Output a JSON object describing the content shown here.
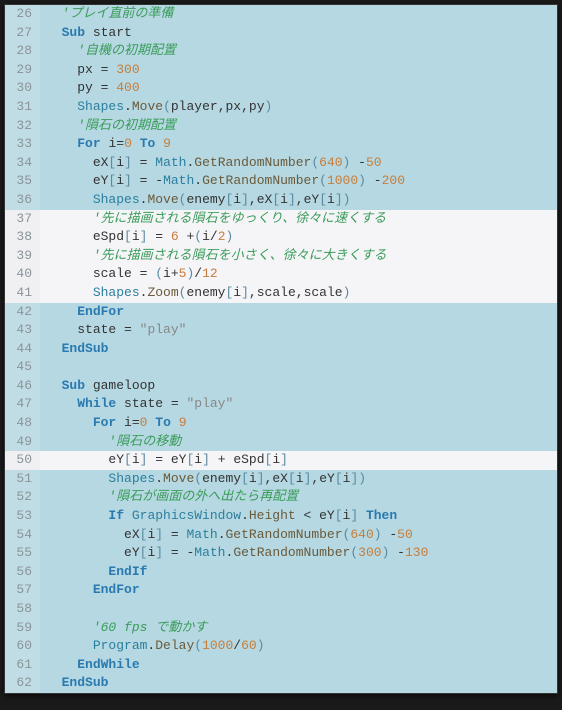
{
  "lines": [
    {
      "n": 26,
      "indent": 1,
      "hl": false,
      "tokens": [
        {
          "t": "'プレイ直前の準備",
          "c": "cm"
        }
      ]
    },
    {
      "n": 27,
      "indent": 1,
      "hl": false,
      "tokens": [
        {
          "t": "Sub",
          "c": "kw"
        },
        {
          "t": " ",
          "c": "op"
        },
        {
          "t": "start",
          "c": "id"
        }
      ]
    },
    {
      "n": 28,
      "indent": 2,
      "hl": false,
      "tokens": [
        {
          "t": "'自機の初期配置",
          "c": "cm"
        }
      ]
    },
    {
      "n": 29,
      "indent": 2,
      "hl": false,
      "tokens": [
        {
          "t": "px",
          "c": "id"
        },
        {
          "t": " = ",
          "c": "op"
        },
        {
          "t": "300",
          "c": "num"
        }
      ]
    },
    {
      "n": 30,
      "indent": 2,
      "hl": false,
      "tokens": [
        {
          "t": "py",
          "c": "id"
        },
        {
          "t": " = ",
          "c": "op"
        },
        {
          "t": "400",
          "c": "num"
        }
      ]
    },
    {
      "n": 31,
      "indent": 2,
      "hl": false,
      "tokens": [
        {
          "t": "Shapes",
          "c": "cls"
        },
        {
          "t": ".",
          "c": "op"
        },
        {
          "t": "Move",
          "c": "fn"
        },
        {
          "t": "(",
          "c": "br"
        },
        {
          "t": "player",
          "c": "id"
        },
        {
          "t": ",",
          "c": "op"
        },
        {
          "t": "px",
          "c": "id"
        },
        {
          "t": ",",
          "c": "op"
        },
        {
          "t": "py",
          "c": "id"
        },
        {
          "t": ")",
          "c": "br"
        }
      ]
    },
    {
      "n": 32,
      "indent": 2,
      "hl": false,
      "tokens": [
        {
          "t": "'隕石の初期配置",
          "c": "cm"
        }
      ]
    },
    {
      "n": 33,
      "indent": 2,
      "hl": false,
      "tokens": [
        {
          "t": "For",
          "c": "kw"
        },
        {
          "t": " ",
          "c": "op"
        },
        {
          "t": "i",
          "c": "id"
        },
        {
          "t": "=",
          "c": "op"
        },
        {
          "t": "0",
          "c": "num"
        },
        {
          "t": " ",
          "c": "op"
        },
        {
          "t": "To",
          "c": "kw"
        },
        {
          "t": " ",
          "c": "op"
        },
        {
          "t": "9",
          "c": "num"
        }
      ]
    },
    {
      "n": 34,
      "indent": 3,
      "hl": false,
      "tokens": [
        {
          "t": "eX",
          "c": "id"
        },
        {
          "t": "[",
          "c": "br"
        },
        {
          "t": "i",
          "c": "id"
        },
        {
          "t": "]",
          "c": "br"
        },
        {
          "t": " = ",
          "c": "op"
        },
        {
          "t": "Math",
          "c": "cls"
        },
        {
          "t": ".",
          "c": "op"
        },
        {
          "t": "GetRandomNumber",
          "c": "fn"
        },
        {
          "t": "(",
          "c": "br"
        },
        {
          "t": "640",
          "c": "num"
        },
        {
          "t": ")",
          "c": "br"
        },
        {
          "t": " -",
          "c": "op"
        },
        {
          "t": "50",
          "c": "num"
        }
      ]
    },
    {
      "n": 35,
      "indent": 3,
      "hl": false,
      "tokens": [
        {
          "t": "eY",
          "c": "id"
        },
        {
          "t": "[",
          "c": "br"
        },
        {
          "t": "i",
          "c": "id"
        },
        {
          "t": "]",
          "c": "br"
        },
        {
          "t": " = -",
          "c": "op"
        },
        {
          "t": "Math",
          "c": "cls"
        },
        {
          "t": ".",
          "c": "op"
        },
        {
          "t": "GetRandomNumber",
          "c": "fn"
        },
        {
          "t": "(",
          "c": "br"
        },
        {
          "t": "1000",
          "c": "num"
        },
        {
          "t": ")",
          "c": "br"
        },
        {
          "t": " -",
          "c": "op"
        },
        {
          "t": "200",
          "c": "num"
        }
      ]
    },
    {
      "n": 36,
      "indent": 3,
      "hl": false,
      "tokens": [
        {
          "t": "Shapes",
          "c": "cls"
        },
        {
          "t": ".",
          "c": "op"
        },
        {
          "t": "Move",
          "c": "fn"
        },
        {
          "t": "(",
          "c": "br"
        },
        {
          "t": "enemy",
          "c": "id"
        },
        {
          "t": "[",
          "c": "br"
        },
        {
          "t": "i",
          "c": "id"
        },
        {
          "t": "]",
          "c": "br"
        },
        {
          "t": ",",
          "c": "op"
        },
        {
          "t": "eX",
          "c": "id"
        },
        {
          "t": "[",
          "c": "br"
        },
        {
          "t": "i",
          "c": "id"
        },
        {
          "t": "]",
          "c": "br"
        },
        {
          "t": ",",
          "c": "op"
        },
        {
          "t": "eY",
          "c": "id"
        },
        {
          "t": "[",
          "c": "br"
        },
        {
          "t": "i",
          "c": "id"
        },
        {
          "t": "]",
          "c": "br"
        },
        {
          "t": ")",
          "c": "br"
        }
      ]
    },
    {
      "n": 37,
      "indent": 3,
      "hl": true,
      "tokens": [
        {
          "t": "'先に描画される隕石をゆっくり、徐々に速くする",
          "c": "cm"
        }
      ]
    },
    {
      "n": 38,
      "indent": 3,
      "hl": true,
      "tokens": [
        {
          "t": "eSpd",
          "c": "id"
        },
        {
          "t": "[",
          "c": "br"
        },
        {
          "t": "i",
          "c": "id"
        },
        {
          "t": "]",
          "c": "br"
        },
        {
          "t": " = ",
          "c": "op"
        },
        {
          "t": "6",
          "c": "num"
        },
        {
          "t": " +",
          "c": "op"
        },
        {
          "t": "(",
          "c": "br"
        },
        {
          "t": "i",
          "c": "id"
        },
        {
          "t": "/",
          "c": "op"
        },
        {
          "t": "2",
          "c": "num"
        },
        {
          "t": ")",
          "c": "br"
        }
      ]
    },
    {
      "n": 39,
      "indent": 3,
      "hl": true,
      "tokens": [
        {
          "t": "'先に描画される隕石を小さく、徐々に大きくする",
          "c": "cm"
        }
      ]
    },
    {
      "n": 40,
      "indent": 3,
      "hl": true,
      "tokens": [
        {
          "t": "scale",
          "c": "id"
        },
        {
          "t": " = ",
          "c": "op"
        },
        {
          "t": "(",
          "c": "br"
        },
        {
          "t": "i",
          "c": "id"
        },
        {
          "t": "+",
          "c": "op"
        },
        {
          "t": "5",
          "c": "num"
        },
        {
          "t": ")",
          "c": "br"
        },
        {
          "t": "/",
          "c": "op"
        },
        {
          "t": "12",
          "c": "num"
        }
      ]
    },
    {
      "n": 41,
      "indent": 3,
      "hl": true,
      "tokens": [
        {
          "t": "Shapes",
          "c": "cls"
        },
        {
          "t": ".",
          "c": "op"
        },
        {
          "t": "Zoom",
          "c": "fn"
        },
        {
          "t": "(",
          "c": "br"
        },
        {
          "t": "enemy",
          "c": "id"
        },
        {
          "t": "[",
          "c": "br"
        },
        {
          "t": "i",
          "c": "id"
        },
        {
          "t": "]",
          "c": "br"
        },
        {
          "t": ",",
          "c": "op"
        },
        {
          "t": "scale",
          "c": "id"
        },
        {
          "t": ",",
          "c": "op"
        },
        {
          "t": "scale",
          "c": "id"
        },
        {
          "t": ")",
          "c": "br"
        }
      ]
    },
    {
      "n": 42,
      "indent": 2,
      "hl": false,
      "tokens": [
        {
          "t": "EndFor",
          "c": "kw"
        }
      ]
    },
    {
      "n": 43,
      "indent": 2,
      "hl": false,
      "tokens": [
        {
          "t": "state",
          "c": "id"
        },
        {
          "t": " = ",
          "c": "op"
        },
        {
          "t": "\"play\"",
          "c": "str"
        }
      ]
    },
    {
      "n": 44,
      "indent": 1,
      "hl": false,
      "tokens": [
        {
          "t": "EndSub",
          "c": "kw"
        }
      ]
    },
    {
      "n": 45,
      "indent": 1,
      "hl": false,
      "tokens": []
    },
    {
      "n": 46,
      "indent": 1,
      "hl": false,
      "tokens": [
        {
          "t": "Sub",
          "c": "kw"
        },
        {
          "t": " ",
          "c": "op"
        },
        {
          "t": "gameloop",
          "c": "id"
        }
      ]
    },
    {
      "n": 47,
      "indent": 2,
      "hl": false,
      "tokens": [
        {
          "t": "While",
          "c": "kw"
        },
        {
          "t": " ",
          "c": "op"
        },
        {
          "t": "state",
          "c": "id"
        },
        {
          "t": " = ",
          "c": "op"
        },
        {
          "t": "\"play\"",
          "c": "str"
        }
      ]
    },
    {
      "n": 48,
      "indent": 3,
      "hl": false,
      "tokens": [
        {
          "t": "For",
          "c": "kw"
        },
        {
          "t": " ",
          "c": "op"
        },
        {
          "t": "i",
          "c": "id"
        },
        {
          "t": "=",
          "c": "op"
        },
        {
          "t": "0",
          "c": "num"
        },
        {
          "t": " ",
          "c": "op"
        },
        {
          "t": "To",
          "c": "kw"
        },
        {
          "t": " ",
          "c": "op"
        },
        {
          "t": "9",
          "c": "num"
        }
      ]
    },
    {
      "n": 49,
      "indent": 4,
      "hl": false,
      "tokens": [
        {
          "t": "'隕石の移動",
          "c": "cm"
        }
      ]
    },
    {
      "n": 50,
      "indent": 4,
      "hl": true,
      "tokens": [
        {
          "t": "eY",
          "c": "id"
        },
        {
          "t": "[",
          "c": "br"
        },
        {
          "t": "i",
          "c": "id"
        },
        {
          "t": "]",
          "c": "br"
        },
        {
          "t": " = ",
          "c": "op"
        },
        {
          "t": "eY",
          "c": "id"
        },
        {
          "t": "[",
          "c": "br"
        },
        {
          "t": "i",
          "c": "id"
        },
        {
          "t": "]",
          "c": "br"
        },
        {
          "t": " + ",
          "c": "op"
        },
        {
          "t": "eSpd",
          "c": "id"
        },
        {
          "t": "[",
          "c": "br"
        },
        {
          "t": "i",
          "c": "id"
        },
        {
          "t": "]",
          "c": "br"
        }
      ]
    },
    {
      "n": 51,
      "indent": 4,
      "hl": false,
      "tokens": [
        {
          "t": "Shapes",
          "c": "cls"
        },
        {
          "t": ".",
          "c": "op"
        },
        {
          "t": "Move",
          "c": "fn"
        },
        {
          "t": "(",
          "c": "br"
        },
        {
          "t": "enemy",
          "c": "id"
        },
        {
          "t": "[",
          "c": "br"
        },
        {
          "t": "i",
          "c": "id"
        },
        {
          "t": "]",
          "c": "br"
        },
        {
          "t": ",",
          "c": "op"
        },
        {
          "t": "eX",
          "c": "id"
        },
        {
          "t": "[",
          "c": "br"
        },
        {
          "t": "i",
          "c": "id"
        },
        {
          "t": "]",
          "c": "br"
        },
        {
          "t": ",",
          "c": "op"
        },
        {
          "t": "eY",
          "c": "id"
        },
        {
          "t": "[",
          "c": "br"
        },
        {
          "t": "i",
          "c": "id"
        },
        {
          "t": "]",
          "c": "br"
        },
        {
          "t": ")",
          "c": "br"
        }
      ]
    },
    {
      "n": 52,
      "indent": 4,
      "hl": false,
      "tokens": [
        {
          "t": "'隕石が画面の外へ出たら再配置",
          "c": "cm"
        }
      ]
    },
    {
      "n": 53,
      "indent": 4,
      "hl": false,
      "tokens": [
        {
          "t": "If",
          "c": "kw"
        },
        {
          "t": " ",
          "c": "op"
        },
        {
          "t": "GraphicsWindow",
          "c": "cls"
        },
        {
          "t": ".",
          "c": "op"
        },
        {
          "t": "Height",
          "c": "fn"
        },
        {
          "t": " < ",
          "c": "op"
        },
        {
          "t": "eY",
          "c": "id"
        },
        {
          "t": "[",
          "c": "br"
        },
        {
          "t": "i",
          "c": "id"
        },
        {
          "t": "]",
          "c": "br"
        },
        {
          "t": " ",
          "c": "op"
        },
        {
          "t": "Then",
          "c": "kw"
        }
      ]
    },
    {
      "n": 54,
      "indent": 5,
      "hl": false,
      "tokens": [
        {
          "t": "eX",
          "c": "id"
        },
        {
          "t": "[",
          "c": "br"
        },
        {
          "t": "i",
          "c": "id"
        },
        {
          "t": "]",
          "c": "br"
        },
        {
          "t": " = ",
          "c": "op"
        },
        {
          "t": "Math",
          "c": "cls"
        },
        {
          "t": ".",
          "c": "op"
        },
        {
          "t": "GetRandomNumber",
          "c": "fn"
        },
        {
          "t": "(",
          "c": "br"
        },
        {
          "t": "640",
          "c": "num"
        },
        {
          "t": ")",
          "c": "br"
        },
        {
          "t": " -",
          "c": "op"
        },
        {
          "t": "50",
          "c": "num"
        }
      ]
    },
    {
      "n": 55,
      "indent": 5,
      "hl": false,
      "tokens": [
        {
          "t": "eY",
          "c": "id"
        },
        {
          "t": "[",
          "c": "br"
        },
        {
          "t": "i",
          "c": "id"
        },
        {
          "t": "]",
          "c": "br"
        },
        {
          "t": " = -",
          "c": "op"
        },
        {
          "t": "Math",
          "c": "cls"
        },
        {
          "t": ".",
          "c": "op"
        },
        {
          "t": "GetRandomNumber",
          "c": "fn"
        },
        {
          "t": "(",
          "c": "br"
        },
        {
          "t": "300",
          "c": "num"
        },
        {
          "t": ")",
          "c": "br"
        },
        {
          "t": " -",
          "c": "op"
        },
        {
          "t": "130",
          "c": "num"
        }
      ]
    },
    {
      "n": 56,
      "indent": 4,
      "hl": false,
      "tokens": [
        {
          "t": "EndIf",
          "c": "kw"
        }
      ]
    },
    {
      "n": 57,
      "indent": 3,
      "hl": false,
      "tokens": [
        {
          "t": "EndFor",
          "c": "kw"
        }
      ]
    },
    {
      "n": 58,
      "indent": 3,
      "hl": false,
      "tokens": []
    },
    {
      "n": 59,
      "indent": 3,
      "hl": false,
      "tokens": [
        {
          "t": "'60 fps で動かす",
          "c": "cm"
        }
      ]
    },
    {
      "n": 60,
      "indent": 3,
      "hl": false,
      "tokens": [
        {
          "t": "Program",
          "c": "cls"
        },
        {
          "t": ".",
          "c": "op"
        },
        {
          "t": "Delay",
          "c": "fn"
        },
        {
          "t": "(",
          "c": "br"
        },
        {
          "t": "1000",
          "c": "num"
        },
        {
          "t": "/",
          "c": "op"
        },
        {
          "t": "60",
          "c": "num"
        },
        {
          "t": ")",
          "c": "br"
        }
      ]
    },
    {
      "n": 61,
      "indent": 2,
      "hl": false,
      "tokens": [
        {
          "t": "EndWhile",
          "c": "kw"
        }
      ]
    },
    {
      "n": 62,
      "indent": 1,
      "hl": false,
      "tokens": [
        {
          "t": "EndSub",
          "c": "kw"
        }
      ]
    }
  ]
}
